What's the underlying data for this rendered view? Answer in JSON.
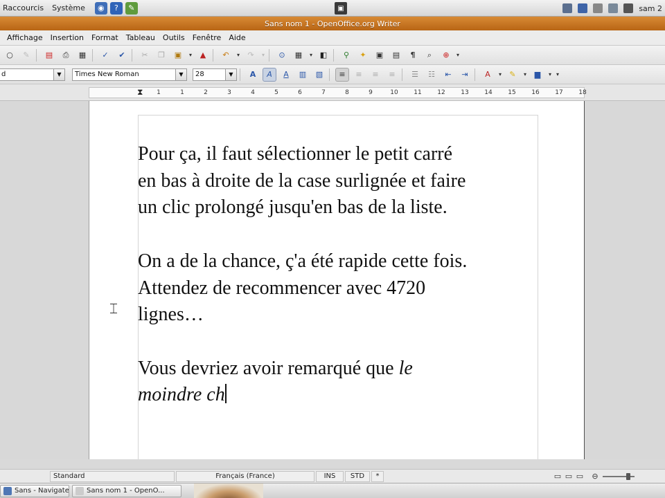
{
  "gnome_panel": {
    "menus": [
      "Raccourcis",
      "Système"
    ],
    "user": "sam 2"
  },
  "window": {
    "title": "Sans nom 1 - OpenOffice.org Writer"
  },
  "menubar": {
    "items": [
      "Affichage",
      "Insertion",
      "Format",
      "Tableau",
      "Outils",
      "Fenêtre",
      "Aide"
    ]
  },
  "formatting": {
    "style_value": "d",
    "font_name": "Times New Roman",
    "font_size": "28"
  },
  "ruler": {
    "numbers": [
      "1",
      "1",
      "2",
      "3",
      "4",
      "5",
      "6",
      "7",
      "8",
      "9",
      "10",
      "11",
      "12",
      "13",
      "14",
      "15",
      "16",
      "17",
      "18"
    ]
  },
  "document": {
    "paragraphs": [
      [
        "Pour ça, il faut sélectionner le petit carré",
        "en bas à droite de la case surlignée et faire",
        "un clic prolongé jusqu'en bas de la liste."
      ],
      [
        "On a de la chance, ç'a été rapide cette fois.",
        "Attendez de recommencer avec 4720",
        "lignes…"
      ]
    ],
    "last_line1_normal": "Vous devriez avoir remarqué que ",
    "last_line1_italic": "le",
    "last_line2_italic": "moindre ch"
  },
  "statusbar": {
    "page_style": "Standard",
    "language": "Français (France)",
    "insert_mode": "INS",
    "selection_mode": "STD",
    "modified": "*"
  },
  "taskbar": {
    "tasks": [
      "Sans - Navigateur ...",
      "Sans nom 1 - OpenO..."
    ]
  },
  "colors": {
    "titlebar": "#c87424",
    "page": "#ffffff",
    "workspace": "#d8d8d8"
  }
}
